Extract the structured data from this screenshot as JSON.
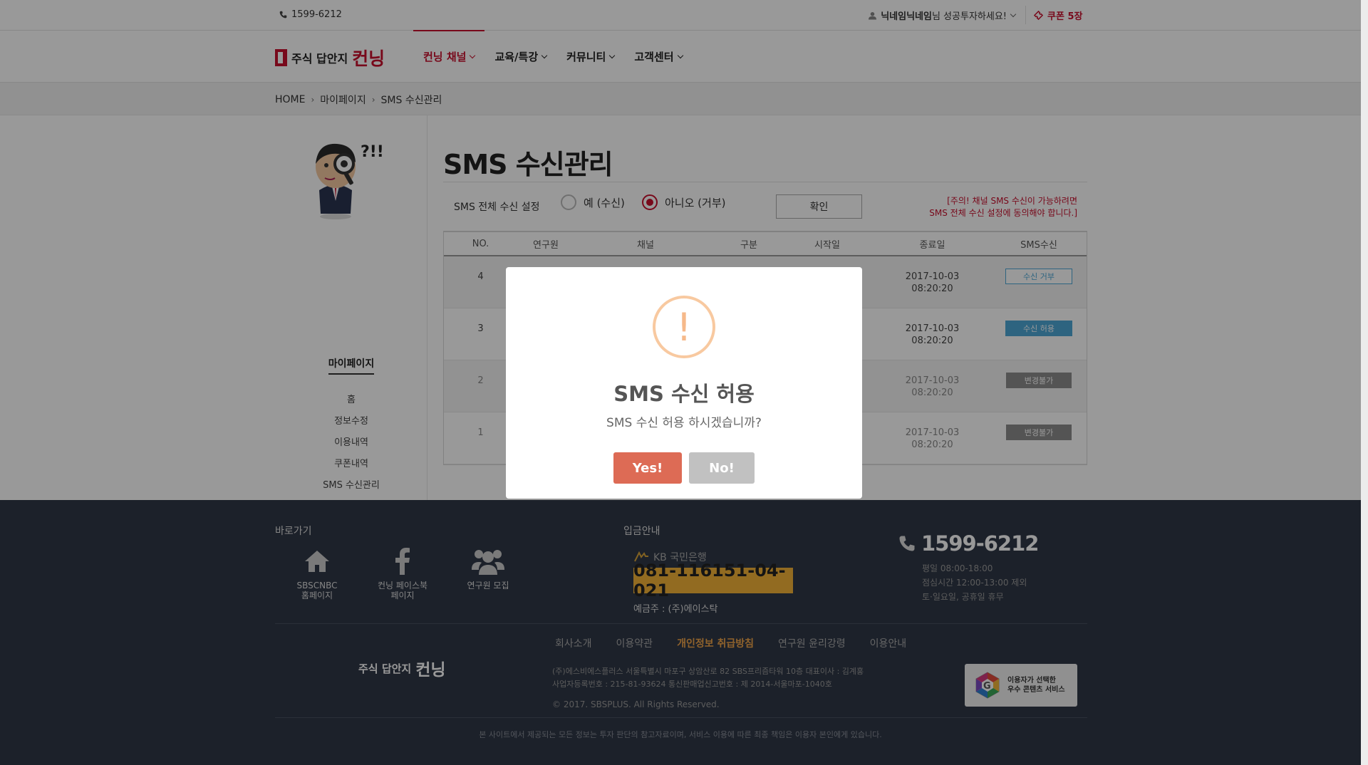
{
  "topbar": {
    "phone": "1599-6212",
    "user_name": "닉네임닉네임",
    "user_greeting": "님 성공투자하세요!",
    "coupon": "쿠폰 5장"
  },
  "header": {
    "logo_small": "주식 답안지",
    "logo_big": "컨닝",
    "nav": [
      {
        "label": "컨닝 채널"
      },
      {
        "label": "교육/특강"
      },
      {
        "label": "커뮤니티"
      },
      {
        "label": "고객센터"
      }
    ]
  },
  "breadcrumb": [
    "HOME",
    "마이페이지",
    "SMS 수신관리"
  ],
  "sidebar": {
    "mascot_text": "?!!",
    "title": "마이페이지",
    "items": [
      {
        "label": "홈"
      },
      {
        "label": "정보수정"
      },
      {
        "label": "이용내역"
      },
      {
        "label": "쿠폰내역"
      },
      {
        "label": "SMS 수신관리"
      }
    ]
  },
  "main": {
    "title": "SMS 수신관리",
    "setting_label": "SMS 전체 수신 설정",
    "radio_yes": "예 (수신)",
    "radio_no": "아니오 (거부)",
    "selected": "no",
    "confirm_label": "확인",
    "notice_1": "[주의! 채널 SMS 수신이 가능하려면",
    "notice_2": "SMS 전체 수신 설정에 동의해야 합니다.]",
    "columns": [
      "NO.",
      "연구원",
      "채널",
      "구분",
      "시작일",
      "종료일",
      "SMS수신"
    ],
    "rows": [
      {
        "no": "4",
        "end_date": "2017-10-03",
        "end_time": "08:20:20",
        "sms": "수신 거부",
        "sms_style": "out"
      },
      {
        "no": "3",
        "end_date": "2017-10-03",
        "end_time": "08:20:20",
        "sms": "수신 허용",
        "sms_style": "in"
      },
      {
        "no": "2",
        "end_date": "2017-10-03",
        "end_time": "08:20:20",
        "sms": "변경불가",
        "sms_style": "off"
      },
      {
        "no": "1",
        "end_date": "2017-10-03",
        "end_time": "08:20:20",
        "sms": "변경불가",
        "sms_style": "off"
      }
    ]
  },
  "footer": {
    "quick_title": "바로가기",
    "quick": [
      {
        "label1": "SBSCNBC",
        "label2": "홈페이지",
        "icon": "home-icon"
      },
      {
        "label1": "컨닝 페이스북",
        "label2": "페이지",
        "icon": "facebook-icon"
      },
      {
        "label1": "연구원 모집",
        "label2": "",
        "icon": "users-icon"
      }
    ],
    "deposit_title": "입금안내",
    "bank": "KB 국민은행",
    "account": "081-116151-04-021",
    "holder": "예금주 : (주)에이스탁",
    "phone": "1599-6212",
    "hours_1": "평일 08:00-18:00",
    "hours_2": "점심시간 12:00-13:00 제외",
    "hours_3": "토·일요일, 공휴일 휴무",
    "links": [
      "회사소개",
      "이용약관",
      "개인정보 취급방침",
      "연구원 윤리강령",
      "이용안내"
    ],
    "logo_small": "주식 답안지",
    "logo_big": "컨닝",
    "company_1": "(주)에스비에스플러스    서울특별시 마포구 상암산로 82 SBS프리즘타워 10층    대표이사 : 김계홍",
    "company_2": "사업자등록번호 : 215-81-93624    통신판매업신고번호 : 제 2014-서울마포-1040호",
    "copyright": "© 2017. SBSPLUS. All Rights Reserved.",
    "gbadge_1": "이용자가 선택한",
    "gbadge_2": "우수 콘텐츠 서비스",
    "disclaimer": "본 사이트에서 제공되는 모든 정보는 투자 판단의 참고자료이며, 서비스 이용에 따른 최종 책임은 이용자 본인에게 있습니다."
  },
  "dialog": {
    "icon_glyph": "!",
    "title": "SMS 수신 허용",
    "message": "SMS 수신 허용 하시겠습니까?",
    "yes_label": "Yes!",
    "no_label": "No!"
  },
  "colors": {
    "brand": "#c8102e",
    "sms_blue": "#4ea7d6",
    "dialog_yes": "#dd6b55",
    "dialog_no": "#c1c1c1",
    "account_bg": "#f4b338",
    "footer_bg": "#2f3746"
  }
}
